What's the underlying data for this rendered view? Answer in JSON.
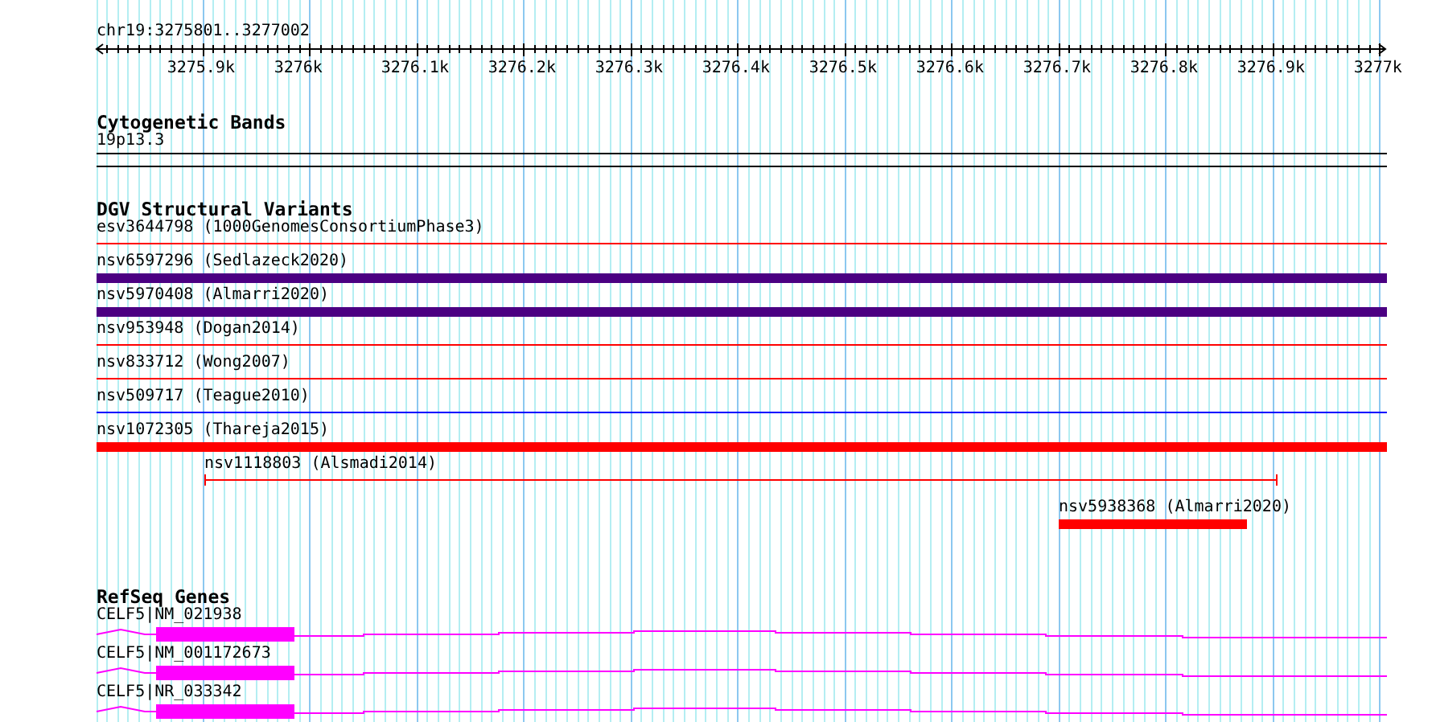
{
  "position": "chr19:3275801..3277002",
  "ruler": {
    "ticks": [
      "3275.9k",
      "3276k",
      "3276.1k",
      "3276.2k",
      "3276.3k",
      "3276.4k",
      "3276.5k",
      "3276.6k",
      "3276.7k",
      "3276.8k",
      "3276.9k",
      "3277k"
    ]
  },
  "cytogenetic_bands": {
    "title": "Cytogenetic Bands",
    "band": "19p13.3"
  },
  "dgv": {
    "title": "DGV Structural Variants",
    "variants": [
      {
        "label": "esv3644798 (1000GenomesConsortiumPhase3)",
        "kind": "line",
        "color": "#ff0000"
      },
      {
        "label": "nsv6597296 (Sedlazeck2020)",
        "kind": "bar",
        "color": "#4b0082"
      },
      {
        "label": "nsv5970408 (Almarri2020)",
        "kind": "bar",
        "color": "#4b0082"
      },
      {
        "label": "nsv953948 (Dogan2014)",
        "kind": "line",
        "color": "#ff0000"
      },
      {
        "label": "nsv833712 (Wong2007)",
        "kind": "line",
        "color": "#ff0000"
      },
      {
        "label": "nsv509717 (Teague2010)",
        "kind": "line",
        "color": "#0000ff"
      },
      {
        "label": "nsv1072305 (Thareja2015)",
        "kind": "bar",
        "color": "#ff0000"
      },
      {
        "label": "nsv1118803 (Alsmadi2014)",
        "kind": "line",
        "color": "#ff0000"
      },
      {
        "label": "nsv5938368 (Almarri2020)",
        "kind": "bar",
        "color": "#ff0000"
      }
    ]
  },
  "refseq": {
    "title": "RefSeq Genes",
    "genes": [
      {
        "label": "CELF5|NM_021938"
      },
      {
        "label": "CELF5|NM_001172673"
      },
      {
        "label": "CELF5|NR_033342"
      }
    ]
  }
}
